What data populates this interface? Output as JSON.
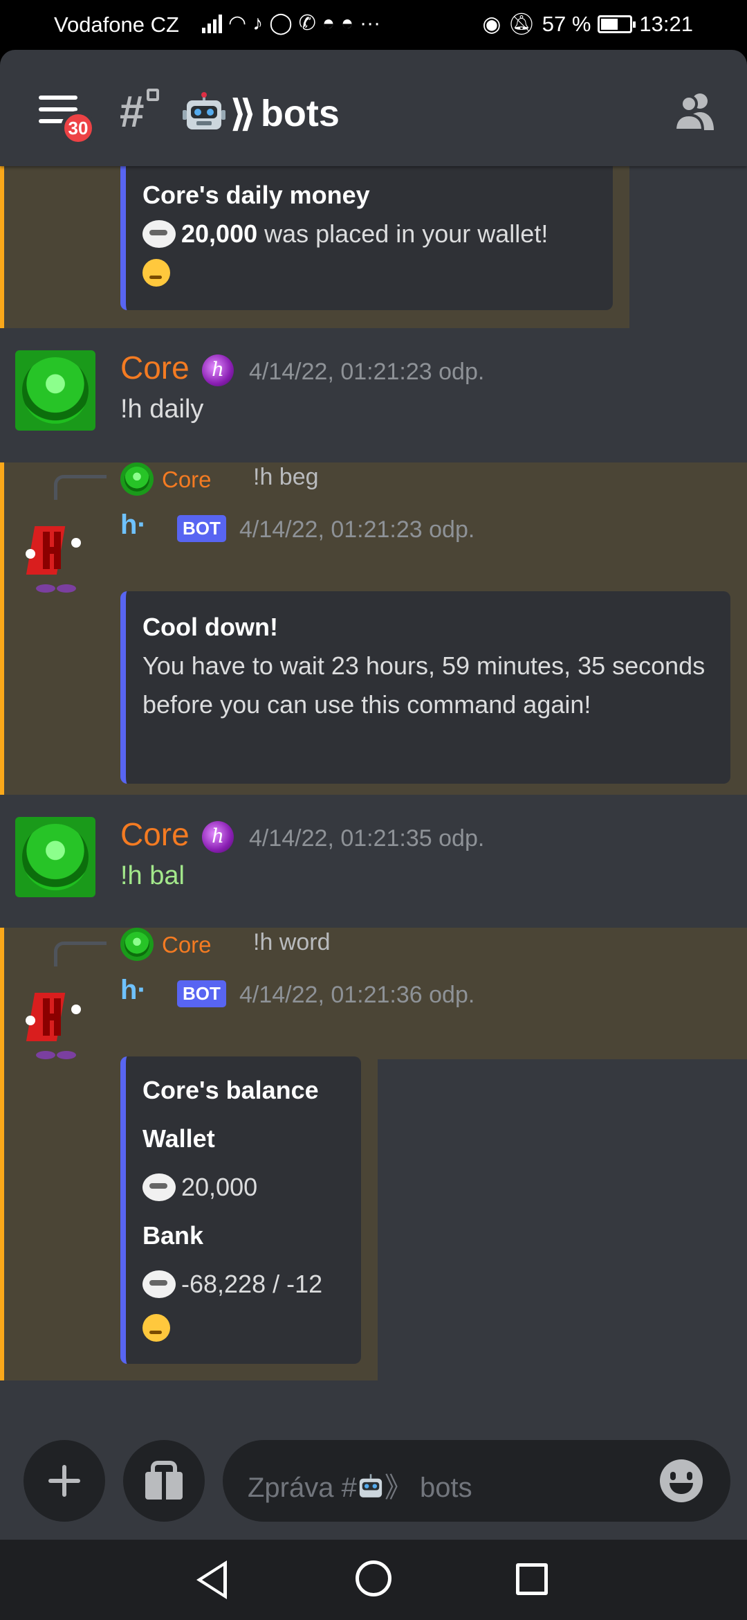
{
  "status_bar": {
    "carrier": "Vodafone CZ",
    "battery": "57 %",
    "time": "13:21"
  },
  "header": {
    "unread_badge": "30",
    "channel_name": "bots",
    "channel_prefix_icon": "robot-emoji"
  },
  "messages": [
    {
      "type": "embed_tail",
      "embed": {
        "title": "Core's daily money",
        "amount": "20,000",
        "text": "was placed in your wallet!"
      }
    },
    {
      "type": "user",
      "username": "Core",
      "timestamp": "4/14/22, 01:21:23 odp.",
      "content": "!h daily"
    },
    {
      "type": "bot_reply",
      "ref_user": "Core",
      "ref_content": "!h beg",
      "bot_name": "h·",
      "bot_tag": "BOT",
      "timestamp": "4/14/22, 01:21:23 odp.",
      "embed": {
        "title": "Cool down!",
        "text": "You have to wait 23 hours, 59 minutes, 35 seconds before you can use this command again!"
      }
    },
    {
      "type": "user",
      "username": "Core",
      "timestamp": "4/14/22, 01:21:35 odp.",
      "content": "!h bal"
    },
    {
      "type": "bot_reply",
      "ref_user": "Core",
      "ref_content": "!h word",
      "bot_name": "h·",
      "bot_tag": "BOT",
      "timestamp": "4/14/22, 01:21:36 odp.",
      "embed": {
        "title": "Core's balance",
        "wallet_label": "Wallet",
        "wallet_value": "20,000",
        "bank_label": "Bank",
        "bank_value": "-68,228 / -12"
      }
    }
  ],
  "composer": {
    "placeholder_prefix": "Zpráva #",
    "placeholder_suffix": "》 bots"
  },
  "colors": {
    "username": "#f47b22",
    "embed_accent": "#5865f2",
    "mention_highlight": "#4b4536",
    "mention_bar": "#faa81a",
    "bot_name": "#6fc2ff",
    "command_green": "#a3e88b"
  }
}
